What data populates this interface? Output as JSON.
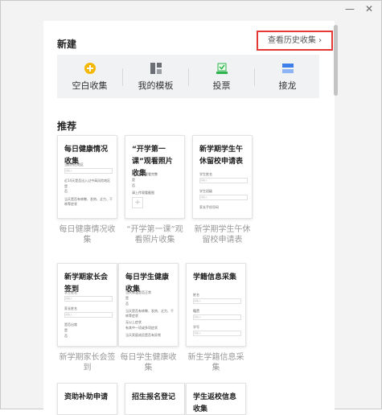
{
  "window": {
    "minimize_icon": "minimize-icon",
    "close_icon": "close-icon"
  },
  "new_section": {
    "title": "新建",
    "history_link": "查看历史收集 ›",
    "quick_actions": [
      {
        "label": "空白收集",
        "icon": "add-circle-icon",
        "color": "#f5b800"
      },
      {
        "label": "我的模板",
        "icon": "template-grid-icon",
        "color": "#6b6f75"
      },
      {
        "label": "投票",
        "icon": "vote-check-icon",
        "color": "#2eb34f"
      },
      {
        "label": "接龙",
        "icon": "relay-list-icon",
        "color": "#3d7eeb"
      }
    ]
  },
  "recommend_section": {
    "title": "推荐",
    "templates": [
      {
        "title": "每日健康情况收集",
        "caption": "每日健康情况收集",
        "questions": [
          "当前所在地区",
          "近14天是否出入过中高风险地区",
          "是",
          "否",
          "当天是否有咳嗽、发热、乏力、干咳等症状"
        ]
      },
      {
        "title": "“开学第一课”观看照片收集",
        "caption": "“开学第一课”观看照片收集",
        "questions": [
          "孩子是否观看完整",
          "是",
          "否",
          "请上传观看截图"
        ]
      },
      {
        "title": "新学期学生午休留校申请表",
        "caption": "新学期学生午休留校申请表",
        "questions": [
          "学生姓名",
          "学生班级",
          "家长手机号码"
        ]
      },
      {
        "title": "新学期家长会签到",
        "caption": "新学期家长会签到",
        "questions": [
          "学生姓名",
          "家长姓名",
          "是否出席",
          "是",
          "否"
        ]
      },
      {
        "title": "每日学生健康收集",
        "caption": "每日学生健康收集",
        "questions": [
          "当天体温是否正常",
          "是",
          "否",
          "当天是否有咳嗽、发热、乏力、干咳等症状",
          "无以上症状",
          "有其中一项或多项症状",
          "当天家庭成员是否有异常"
        ]
      },
      {
        "title": "学籍信息采集",
        "caption": "新生学籍信息采集",
        "questions": [
          "姓名",
          "籍贯",
          "学号"
        ]
      },
      {
        "title": "资助补助申请",
        "caption": "",
        "questions": []
      },
      {
        "title": "招生报名登记",
        "caption": "",
        "questions": []
      },
      {
        "title": "学生返校信息收集",
        "caption": "",
        "questions": []
      }
    ],
    "input_placeholder": "请输入"
  }
}
